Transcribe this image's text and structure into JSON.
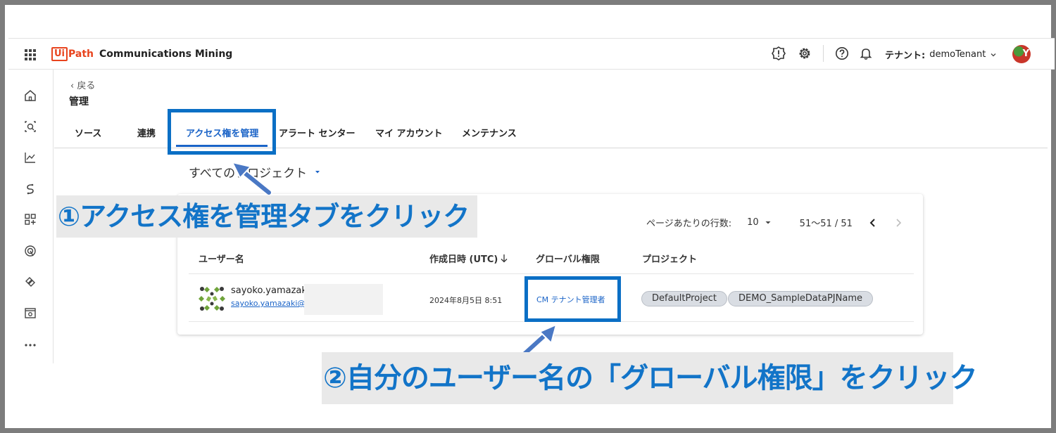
{
  "header": {
    "brand_box": "Ui",
    "brand_path": "Path",
    "product": "Communications Mining",
    "tenant_label": "テナント:",
    "tenant_value": "demoTenant",
    "avatar_letter": "Y"
  },
  "page": {
    "back_label": "‹ 戻る",
    "title": "管理"
  },
  "tabs": [
    {
      "label": "ソース",
      "active": false
    },
    {
      "label": "連携",
      "active": false
    },
    {
      "label": "アクセス権を管理",
      "active": true
    },
    {
      "label": "アラート センター",
      "active": false
    },
    {
      "label": "マイ アカウント",
      "active": false
    },
    {
      "label": "メンテナンス",
      "active": false
    }
  ],
  "project_select": {
    "label": "すべてのプロジェクト"
  },
  "pager": {
    "rows_label": "ページあたりの行数:",
    "rows_value": "10",
    "range": "51〜51 / 51"
  },
  "table": {
    "columns": [
      "ユーザー名",
      "作成日時 (UTC)",
      "グローバル権限",
      "プロジェクト"
    ],
    "rows": [
      {
        "name": "sayoko.yamazaki",
        "email": "sayoko.yamazaki@g",
        "created": "2024年8月5日 8:51",
        "global_permission": "CM テナント管理者",
        "projects": [
          "DefaultProject",
          "DEMO_SampleDataPJName"
        ]
      }
    ]
  },
  "annotations": {
    "step1": "①アクセス権を管理タブをクリック",
    "step2": "②自分のユーザー名の「グローバル権限」をクリック"
  },
  "colors": {
    "accent": "#1a63c7",
    "annotation_blue": "#0b6fc5",
    "brand_orange": "#e8441e"
  },
  "icons": [
    "apps-grid-icon",
    "alert-icon",
    "gear-icon",
    "help-icon",
    "bell-icon",
    "chevron-down-icon",
    "home-icon",
    "discover-icon",
    "chart-icon",
    "connections-icon",
    "add-widget-icon",
    "alerts-radar-icon",
    "integrations-icon",
    "admin-icon",
    "more-icon",
    "chevron-left-icon",
    "chevron-right-icon",
    "sort-down-icon"
  ]
}
